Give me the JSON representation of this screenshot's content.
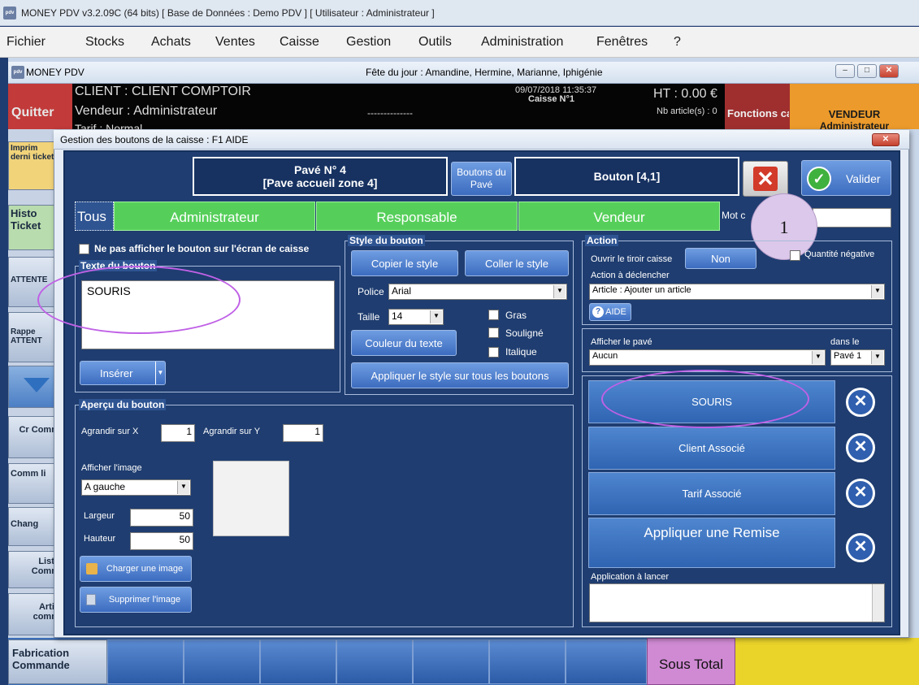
{
  "app": {
    "title": "MONEY PDV v3.2.09C (64 bits) [ Base de Données : Demo PDV ] [ Utilisateur : Administrateur ]",
    "logo": "pdv"
  },
  "menu": [
    "Fichier",
    "Stocks",
    "Achats",
    "Ventes",
    "Caisse",
    "Gestion",
    "Outils",
    "Administration",
    "Fenêtres",
    "?"
  ],
  "mdi": {
    "title": "MONEY PDV",
    "fete": "Fête du jour : Amandine, Hermine, Marianne, Iphigénie",
    "min": "–",
    "max": "□",
    "close": "✕"
  },
  "info": {
    "quit": "Quitter",
    "client": "CLIENT : CLIENT COMPTOIR",
    "vendeur": "Vendeur : Administrateur",
    "tarif": "Tarif : Normal",
    "dashes": "--------------",
    "datetime": "09/07/2018 11:35:37",
    "caisse": "Caisse N°1",
    "ht": "HT : 0.00 €",
    "nb": "Nb article(s) : 0",
    "fonctions": "Fonctions caisse",
    "vendeur_box": "VENDEUR",
    "vendeur_name": "Administrateur"
  },
  "left": {
    "imprimer": "Imprim derni ticket",
    "histo": "Histo Ticket",
    "attente": "ATTENTE",
    "rappel": "Rappe ATTENT",
    "cr": "Cr Comm",
    "comm": "Comm li",
    "chang": "Chang",
    "liste": "Liste Comm",
    "artic": "Artic comm",
    "fabrication": "Fabrication Commande"
  },
  "bottom": {
    "sous_total": "Sous Total"
  },
  "dialog": {
    "title": "Gestion des boutons de la caisse : F1 AIDE",
    "pave_line1": "Pavé N° 4",
    "pave_line2": "[Pave accueil zone 4]",
    "boutons_pave": "Boutons du Pavé",
    "bouton": "Bouton [4,1]",
    "valider": "Valider",
    "tabs": [
      "Tous",
      "Administrateur",
      "Responsable",
      "Vendeur"
    ],
    "mot_cle": "Mot c",
    "annotation": "1",
    "ne_pas_afficher": "Ne pas afficher le bouton sur l'écran de caisse",
    "texte_bouton_label": "Texte du bouton",
    "texte_bouton_value": "SOURIS",
    "inserer": "Insérer",
    "style_label": "Style du bouton",
    "copier": "Copier le style",
    "coller": "Coller le style",
    "police_label": "Police",
    "police_value": "Arial",
    "taille_label": "Taille",
    "taille_value": "14",
    "gras": "Gras",
    "souligne": "Souligné",
    "italique": "Italique",
    "couleur": "Couleur du texte",
    "appliquer_style": "Appliquer le style sur tous les boutons",
    "action_label": "Action",
    "tiroir_label": "Ouvrir le tiroir caisse",
    "tiroir_value": "Non",
    "quantite_negative": "Quantité négative",
    "action_declencher": "Action à déclencher",
    "action_value": "Article : Ajouter un article",
    "aide": "AIDE",
    "afficher_pave": "Afficher le pavé",
    "dans_le": "dans le",
    "pave_value": "Aucun",
    "pave_num": "Pavé 1",
    "apercu_label": "Aperçu du bouton",
    "agrandir_x": "Agrandir sur X",
    "agrandir_x_val": "1",
    "agrandir_y": "Agrandir sur Y",
    "agrandir_y_val": "1",
    "afficher_image": "Afficher l'image",
    "image_pos": "A gauche",
    "largeur": "Largeur",
    "largeur_val": "50",
    "hauteur": "Hauteur",
    "hauteur_val": "50",
    "charger": "Charger une image",
    "supprimer": "Supprimer l'image",
    "btn_souris": "SOURIS",
    "btn_client": "Client Associé",
    "btn_tarif": "Tarif Associé",
    "btn_remise": "Appliquer une Remise",
    "application_label": "Application à lancer"
  },
  "colors": {
    "accent": "#56cf5a",
    "annotation": "#c061e6",
    "panel": "#1f3d70"
  }
}
